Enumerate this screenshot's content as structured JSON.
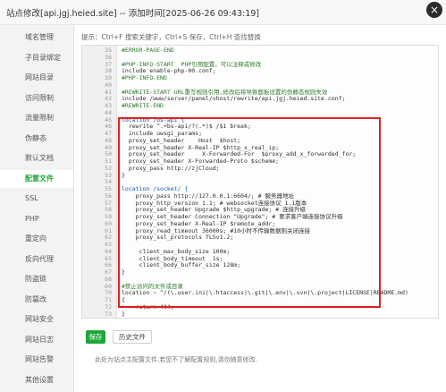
{
  "window": {
    "title": "站点修改[api.jgj.heied.site] -- 添加时间[2025-06-26 09:43:19]",
    "close_icon": "×"
  },
  "sidebar": {
    "items": [
      {
        "label": "域名管理"
      },
      {
        "label": "子目录绑定"
      },
      {
        "label": "网站目录"
      },
      {
        "label": "访问限制"
      },
      {
        "label": "流量限制"
      },
      {
        "label": "伪静态"
      },
      {
        "label": "默认文档"
      },
      {
        "label": "配置文件",
        "active": true
      },
      {
        "label": "SSL"
      },
      {
        "label": "PHP"
      },
      {
        "label": "重定向"
      },
      {
        "label": "反向代理"
      },
      {
        "label": "防盗链"
      },
      {
        "label": "防篡改"
      },
      {
        "label": "网站安全"
      },
      {
        "label": "网站日志"
      },
      {
        "label": "网站告警"
      },
      {
        "label": "其他设置"
      }
    ]
  },
  "editor": {
    "tip": "提示：Ctrl+F 搜索关键字，Ctrl+S 保存，Ctrl+H 查找替换",
    "lines": [
      {
        "n": "35",
        "t": "#ERROR-PAGE-END",
        "c": "c-comment"
      },
      {
        "n": "36",
        "t": ""
      },
      {
        "n": "37",
        "t": "#PHP-INFO-START  PHP引用配置，可以注释或修改",
        "c": "c-comment"
      },
      {
        "n": "38",
        "t": "include enable-php-00.conf;"
      },
      {
        "n": "39",
        "t": "#PHP-INFO-END",
        "c": "c-comment"
      },
      {
        "n": "40",
        "t": ""
      },
      {
        "n": "41",
        "t": "#REWRITE-START URL重写规则引用,修改后将导致面板设置的伪静态规则失效",
        "c": "c-comment"
      },
      {
        "n": "42",
        "t": "include /www/server/panel/vhost/rewrite/api.jgj.heied.site.conf;"
      },
      {
        "n": "43",
        "t": "#REWRITE-END",
        "c": "c-comment"
      },
      {
        "n": "44",
        "t": ""
      },
      {
        "n": "45",
        "t": "location /bs-api {",
        "c": "c-key"
      },
      {
        "n": "46",
        "t": "  rewrite ^.+bs-api/?(.*)$ /$1 break;"
      },
      {
        "n": "47",
        "t": "  include uwsgi_params;"
      },
      {
        "n": "48",
        "t": "  proxy_set_header    Host  $host;"
      },
      {
        "n": "49",
        "t": "  proxy_set_header X-Real-IP $http_x_real_ip;"
      },
      {
        "n": "50",
        "t": "  proxy_set_header     X-Forwarded-For  $proxy_add_x_forwarded_for;"
      },
      {
        "n": "51",
        "t": "  proxy_set_header X-Forwarded-Proto $scheme;"
      },
      {
        "n": "52",
        "t": "  proxy_pass http://zjCloud;"
      },
      {
        "n": "53",
        "t": "}"
      },
      {
        "n": "54",
        "t": ""
      },
      {
        "n": "55",
        "t": "location /socket/ {",
        "c": "c-key"
      },
      {
        "n": "56",
        "t": "    proxy_pass http://127.0.0.1:6604/; # 服务器地址"
      },
      {
        "n": "57",
        "t": "    proxy_http_version 1.1; # websocket连接协议 1.1版本"
      },
      {
        "n": "58",
        "t": "    proxy_set_header Upgrade $http_upgrade; # 连接升级"
      },
      {
        "n": "59",
        "t": "    proxy_set_header Connection \"Upgrade\"; # 要求客户端连接协议升级"
      },
      {
        "n": "60",
        "t": "    proxy_set_header X-Real-IP $remote_addr;"
      },
      {
        "n": "61",
        "t": "    proxy_read_timeout 36000s; #10小时不传输数据则关闭连接"
      },
      {
        "n": "62",
        "t": "    proxy_ssl_protocols TLSv1.2;"
      },
      {
        "n": "63",
        "t": ""
      },
      {
        "n": "64",
        "t": "     client_max_body_size 100m;"
      },
      {
        "n": "65",
        "t": "     client_body_timeout  1s;"
      },
      {
        "n": "66",
        "t": "     client_body_buffer_size 128m;"
      },
      {
        "n": "67",
        "t": "}"
      },
      {
        "n": "68",
        "t": ""
      },
      {
        "n": "69",
        "t": "#禁止访问的文件或目录",
        "c": "c-comment"
      },
      {
        "n": "70",
        "t": "location ~ ^/(\\.user.ini|\\.htaccess|\\.git|\\.env|\\.svn|\\.project|LICENSE|README.md)"
      },
      {
        "n": "71",
        "t": "{"
      },
      {
        "n": "72",
        "t": "    return 404;"
      },
      {
        "n": "73",
        "t": "}"
      }
    ]
  },
  "footer": {
    "save_label": "保存",
    "history_label": "历史文件",
    "note": "此处为站点主配置文件,若您不了解配置规则,请勿随意修改."
  }
}
